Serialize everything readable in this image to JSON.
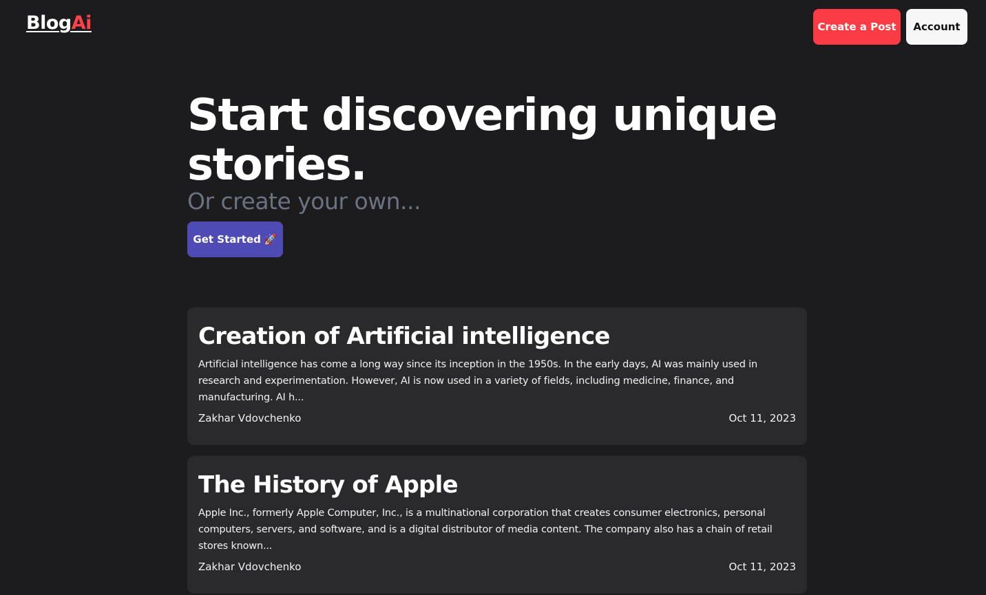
{
  "header": {
    "logo_main": "Blog",
    "logo_accent": "Ai",
    "create_post_label": "Create a Post",
    "account_label": "Account"
  },
  "hero": {
    "title": "Start discovering unique stories.",
    "subtitle": "Or create your own...",
    "cta_label": "Get Started",
    "cta_icon": "🚀"
  },
  "posts": [
    {
      "title": "Creation of Artificial intelligence",
      "excerpt": "Artificial intelligence has come a long way since its inception in the 1950s. In the early days, AI was mainly used in research and experimentation. However, AI is now used in a variety of fields, including medicine, finance, and manufacturing. AI h...",
      "author": "Zakhar Vdovchenko",
      "date": "Oct 11, 2023"
    },
    {
      "title": "The History of Apple",
      "excerpt": "Apple Inc., formerly Apple Computer, Inc., is a multinational corporation that creates consumer electronics, personal computers, servers, and software, and is a digital distributor of media content. The company also has a chain of retail stores known...",
      "author": "Zakhar Vdovchenko",
      "date": "Oct 11, 2023"
    }
  ],
  "colors": {
    "background": "#1c1c1e",
    "card": "#2a2a2c",
    "accent_red": "#fb3c44",
    "accent_purple": "#4f4bb5",
    "muted": "#6b7280"
  }
}
